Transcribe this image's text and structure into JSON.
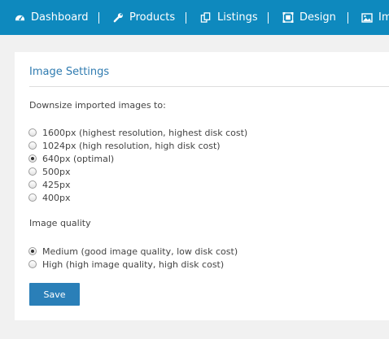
{
  "nav": {
    "items": [
      {
        "label": "Dashboard",
        "icon": "dashboard-icon"
      },
      {
        "label": "Products",
        "icon": "wrench-icon"
      },
      {
        "label": "Listings",
        "icon": "copy-icon"
      },
      {
        "label": "Design",
        "icon": "design-icon"
      },
      {
        "label": "Im",
        "icon": "image-icon"
      }
    ]
  },
  "panel": {
    "title": "Image Settings",
    "downsize": {
      "label": "Downsize imported images to:",
      "options": [
        {
          "label": "1600px (highest resolution, highest disk cost)",
          "checked": false
        },
        {
          "label": "1024px (high resolution, high disk cost)",
          "checked": false
        },
        {
          "label": "640px (optimal)",
          "checked": true
        },
        {
          "label": "500px",
          "checked": false
        },
        {
          "label": "425px",
          "checked": false
        },
        {
          "label": "400px",
          "checked": false
        }
      ]
    },
    "quality": {
      "label": "Image quality",
      "options": [
        {
          "label": "Medium (good image quality, low disk cost)",
          "checked": true
        },
        {
          "label": "High (high image quality, high disk cost)",
          "checked": false
        }
      ]
    },
    "save_label": "Save"
  },
  "colors": {
    "nav_background": "#0e89be",
    "title": "#2f7bb0",
    "button": "#2a7fb8",
    "page_background": "#f1f1f1"
  }
}
